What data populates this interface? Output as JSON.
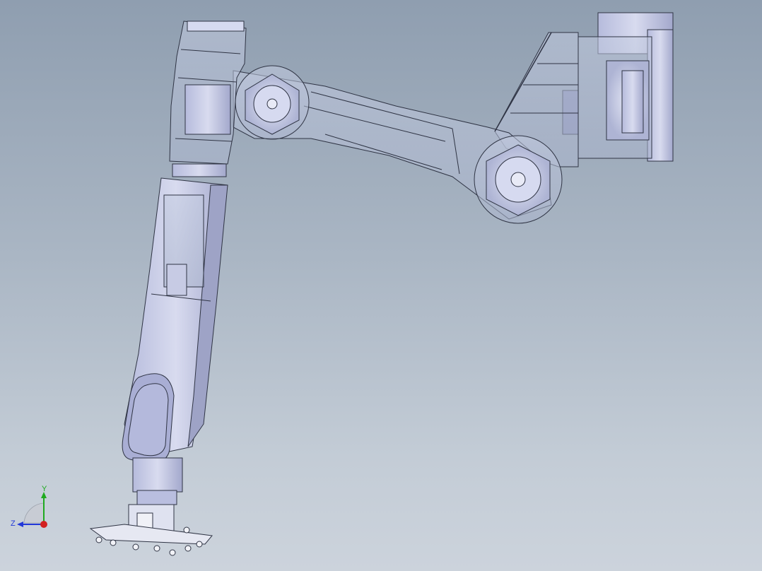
{
  "viewport": {
    "background_top": "#8f9eb0",
    "background_bottom": "#ccd3dc"
  },
  "model": {
    "part_fill": "#c9cde6",
    "part_fill_dark": "#a9aed0",
    "edge_color": "#2f3444",
    "transparent_fill": "#b8c2d8"
  },
  "triad": {
    "x_color": "#d22020",
    "y_color": "#1faa1f",
    "z_color": "#2238d8",
    "y_label": "Y",
    "z_label": "Z"
  }
}
